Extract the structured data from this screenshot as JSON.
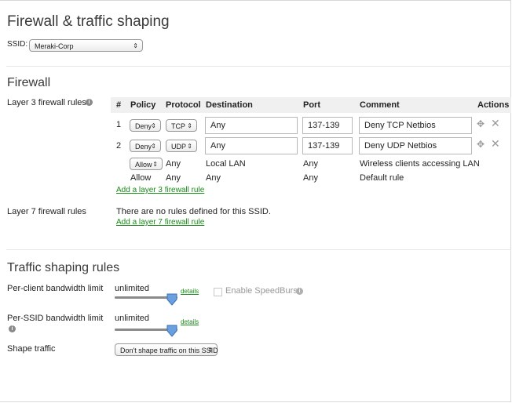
{
  "page": {
    "title": "Firewall & traffic shaping",
    "ssid_label": "SSID:",
    "ssid_value": "Meraki-Corp"
  },
  "firewall": {
    "heading": "Firewall",
    "l3_label": "Layer 3 firewall rules",
    "columns": [
      "#",
      "Policy",
      "Protocol",
      "Destination",
      "Port",
      "Comment",
      "Actions"
    ],
    "rules": [
      {
        "num": "1",
        "policy": "Deny",
        "protocol": "TCP",
        "destination": "Any",
        "port": "137-139",
        "comment": "Deny TCP Netbios"
      },
      {
        "num": "2",
        "policy": "Deny",
        "protocol": "UDP",
        "destination": "Any",
        "port": "137-139",
        "comment": "Deny UDP Netbios"
      }
    ],
    "lan_rule": {
      "policy": "Allow",
      "protocol": "Any",
      "destination": "Local LAN",
      "port": "Any",
      "comment": "Wireless clients accessing LAN"
    },
    "default_rule": {
      "policy": "Allow",
      "protocol": "Any",
      "destination": "Any",
      "port": "Any",
      "comment": "Default rule"
    },
    "add_l3_link": "Add a layer 3 firewall rule",
    "l7_label": "Layer 7 firewall rules",
    "l7_empty": "There are no rules defined for this SSID.",
    "add_l7_link": "Add a layer 7 firewall rule"
  },
  "traffic": {
    "heading": "Traffic shaping rules",
    "per_client_label": "Per-client bandwidth limit",
    "per_client_value": "unlimited",
    "per_client_details": "details",
    "speedburst_label": "Enable SpeedBurst",
    "per_ssid_label": "Per-SSID bandwidth limit",
    "per_ssid_value": "unlimited",
    "per_ssid_details": "details",
    "shape_label": "Shape traffic",
    "shape_value": "Don't shape traffic on this SSID"
  },
  "colors": {
    "link": "#1a8a1a",
    "info_icon": "#8a8a8a",
    "header_bg": "#f0f0f0"
  }
}
